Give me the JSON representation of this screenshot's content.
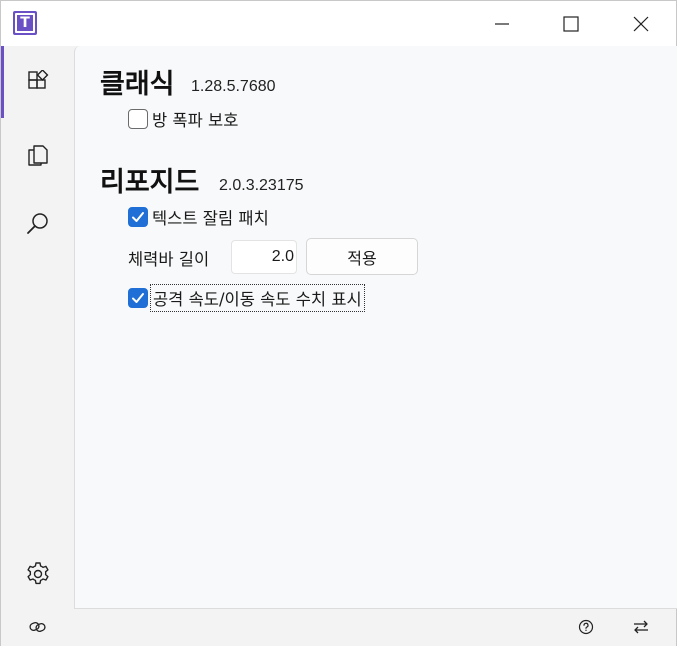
{
  "app": {
    "logo_letter": "T",
    "accent_color": "#6b4fc4",
    "checkbox_color": "#1f6fd6"
  },
  "titlebar": {
    "minimize_icon": "minimize-icon",
    "maximize_icon": "maximize-icon",
    "close_icon": "close-icon"
  },
  "nav": {
    "items": [
      {
        "icon": "apps-icon",
        "active": true
      },
      {
        "icon": "copy-icon",
        "active": false
      },
      {
        "icon": "search-icon",
        "active": false
      }
    ],
    "settings_icon": "gear-icon"
  },
  "sections": {
    "classic": {
      "title": "클래식",
      "version": "1.28.5.7680",
      "options": [
        {
          "label": "방 폭파 보호",
          "checked": false
        }
      ]
    },
    "reforged": {
      "title": "리포지드",
      "version": "2.0.3.23175",
      "text_patch": {
        "label": "텍스트 잘림 패치",
        "checked": true
      },
      "hpbar": {
        "label": "체력바 길이",
        "value": "2.0",
        "apply_label": "적용"
      },
      "speed_display": {
        "label": "공격 속도/이동 속도 수치 표시",
        "checked": true
      }
    }
  },
  "bottombar": {
    "left_icon": "link-icon",
    "help_icon": "help-icon",
    "swap_icon": "swap-icon"
  }
}
